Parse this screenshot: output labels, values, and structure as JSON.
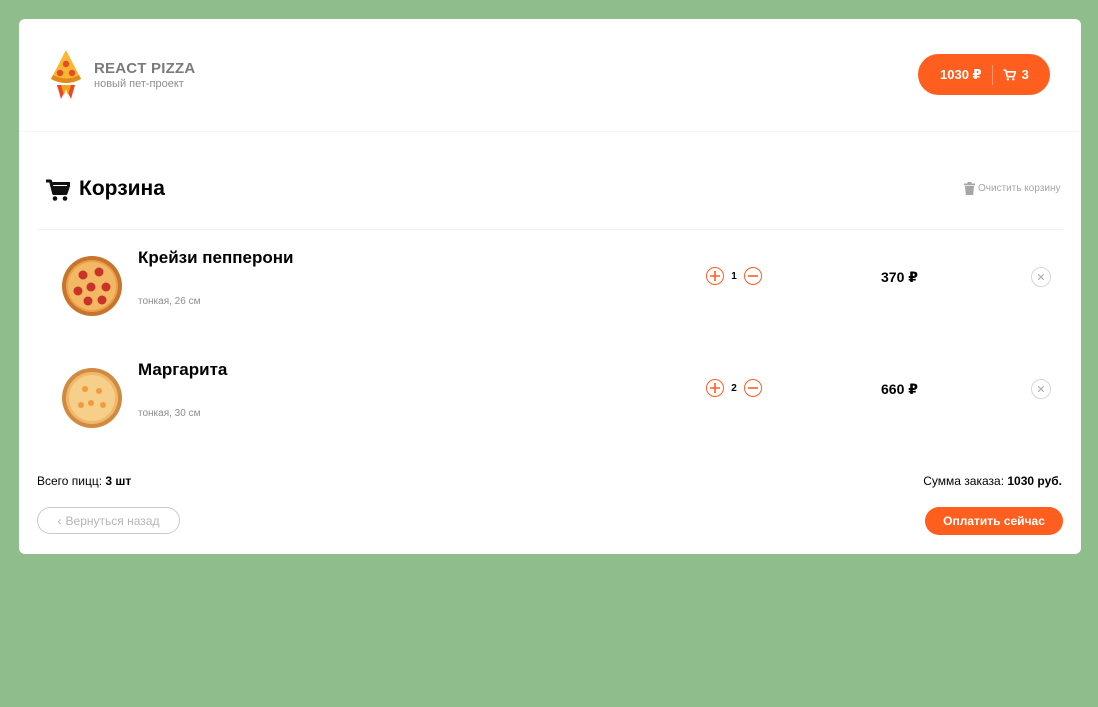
{
  "header": {
    "brand_title": "REACT PIZZA",
    "brand_subtitle": "новый пет-проект",
    "cart_price": "1030 ₽",
    "cart_count": "3"
  },
  "cart": {
    "title": "Корзина",
    "clear_label": "Очистить корзину",
    "items": [
      {
        "name": "Крейзи пепперони",
        "desc": "тонкая, 26 см",
        "count": "1",
        "price": "370 ₽"
      },
      {
        "name": "Маргарита",
        "desc": "тонкая, 30 см",
        "count": "2",
        "price": "660 ₽"
      }
    ]
  },
  "footer": {
    "total_label": "Всего пицц: ",
    "total_value": "3 шт",
    "sum_label": "Сумма заказа: ",
    "sum_value": "1030 руб.",
    "back_label": "Вернуться назад",
    "pay_label": "Оплатить сейчас"
  },
  "colors": {
    "accent": "#fe5f1e",
    "background": "#8fbd8c"
  },
  "icons": [
    "pizza-logo-icon",
    "cart-icon",
    "trash-icon",
    "plus-icon",
    "minus-icon",
    "close-icon",
    "chevron-left-icon"
  ]
}
